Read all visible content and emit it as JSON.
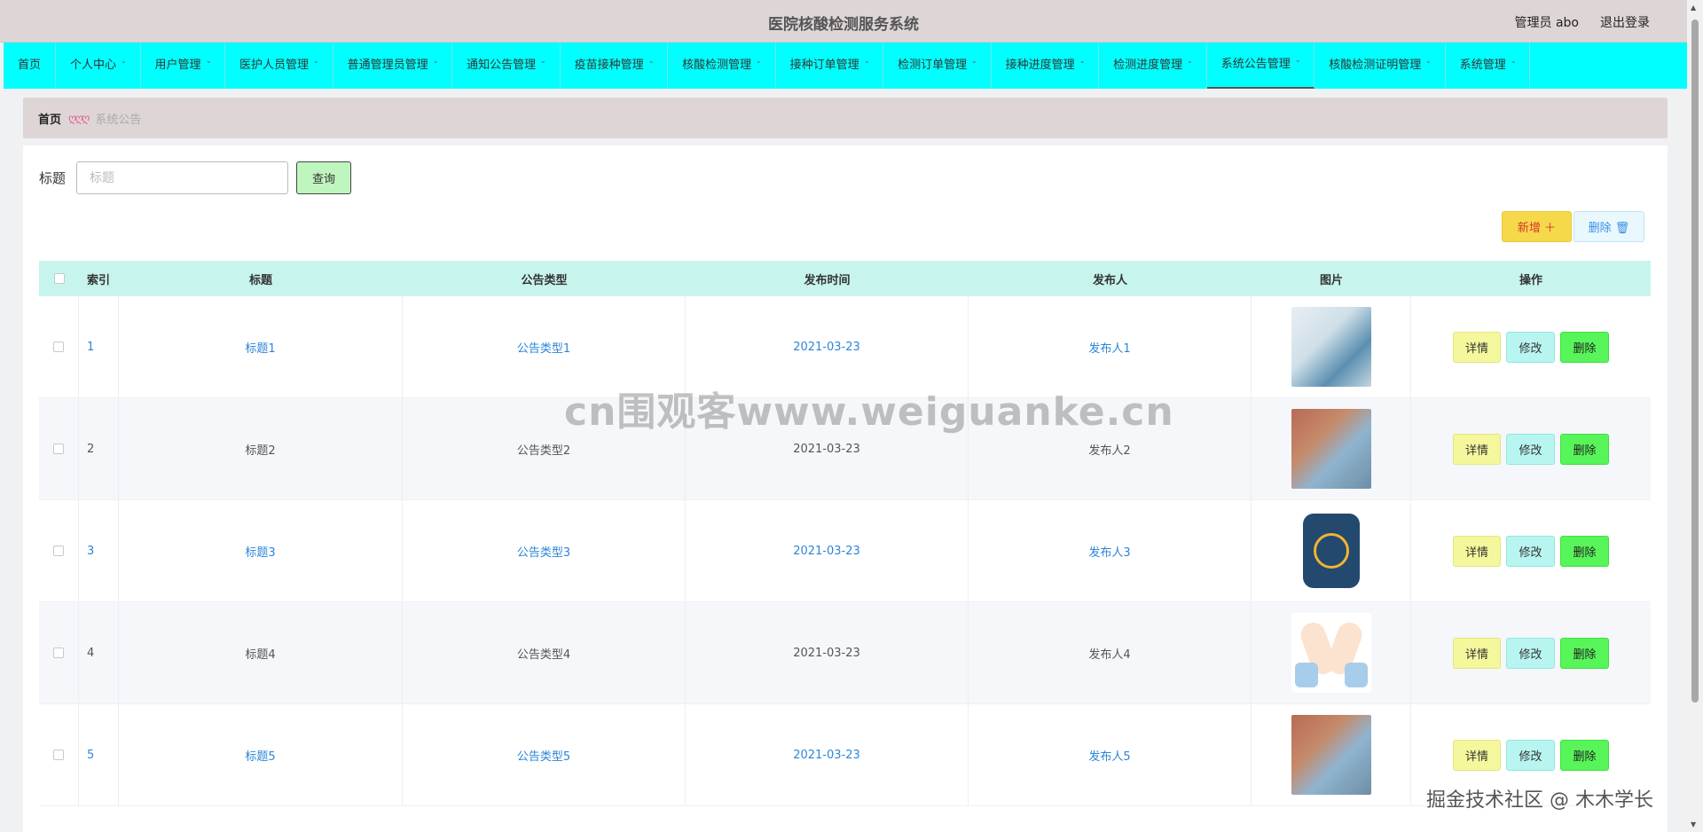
{
  "app": {
    "title": "医院核酸检测服务系统",
    "user_label": "管理员 abo",
    "logout_label": "退出登录"
  },
  "nav": {
    "items": [
      {
        "label": "首页",
        "has_dropdown": false,
        "active": false
      },
      {
        "label": "个人中心",
        "has_dropdown": true,
        "active": false
      },
      {
        "label": "用户管理",
        "has_dropdown": true,
        "active": false
      },
      {
        "label": "医护人员管理",
        "has_dropdown": true,
        "active": false
      },
      {
        "label": "普通管理员管理",
        "has_dropdown": true,
        "active": false
      },
      {
        "label": "通知公告管理",
        "has_dropdown": true,
        "active": false
      },
      {
        "label": "疫苗接种管理",
        "has_dropdown": true,
        "active": false
      },
      {
        "label": "核酸检测管理",
        "has_dropdown": true,
        "active": false
      },
      {
        "label": "接种订单管理",
        "has_dropdown": true,
        "active": false
      },
      {
        "label": "检测订单管理",
        "has_dropdown": true,
        "active": false
      },
      {
        "label": "接种进度管理",
        "has_dropdown": true,
        "active": false
      },
      {
        "label": "检测进度管理",
        "has_dropdown": true,
        "active": false
      },
      {
        "label": "系统公告管理",
        "has_dropdown": true,
        "active": true
      },
      {
        "label": "核酸检测证明管理",
        "has_dropdown": true,
        "active": false
      },
      {
        "label": "系统管理",
        "has_dropdown": true,
        "active": false
      }
    ]
  },
  "breadcrumb": {
    "home": "首页",
    "separator": "ღღღ",
    "current": "系统公告"
  },
  "search": {
    "label": "标题",
    "placeholder": "标题",
    "value": "",
    "button_label": "查询"
  },
  "toolbar": {
    "add_label": "新增 ＋",
    "delete_label": "删除 🗑"
  },
  "table": {
    "headers": {
      "index": "索引",
      "title": "标题",
      "type": "公告类型",
      "time": "发布时间",
      "publisher": "发布人",
      "image": "图片",
      "ops": "操作"
    },
    "rows": [
      {
        "index": "1",
        "title": "标题1",
        "type": "公告类型1",
        "time": "2021-03-23",
        "publisher": "发布人1",
        "image": "doctor-laptop-photo"
      },
      {
        "index": "2",
        "title": "标题2",
        "type": "公告类型2",
        "time": "2021-03-23",
        "publisher": "发布人2",
        "image": "face-mask-photo"
      },
      {
        "index": "3",
        "title": "标题3",
        "type": "公告类型3",
        "time": "2021-03-23",
        "publisher": "发布人3",
        "image": "app-icon-photo"
      },
      {
        "index": "4",
        "title": "标题4",
        "type": "公告类型4",
        "time": "2021-03-23",
        "publisher": "发布人4",
        "image": "heart-hands-photo"
      },
      {
        "index": "5",
        "title": "标题5",
        "type": "公告类型5",
        "time": "2021-03-23",
        "publisher": "发布人5",
        "image": "face-mask-photo"
      }
    ],
    "row_actions": {
      "detail": "详情",
      "edit": "修改",
      "delete": "删除"
    }
  },
  "overlay": {
    "watermark": "cn围观客www.weiguanke.cn",
    "credit": "掘金技术社区 @ 木木学长"
  },
  "colors": {
    "nav_bg": "#00ffff",
    "header_bg": "#ded6d6",
    "table_header_bg": "#c7f5ee",
    "link": "#2b86d8",
    "add_button": "#f5d94a",
    "detail_button": "#f4f79b",
    "edit_button": "#b8f5f0",
    "delete_row_button": "#58f55a"
  }
}
